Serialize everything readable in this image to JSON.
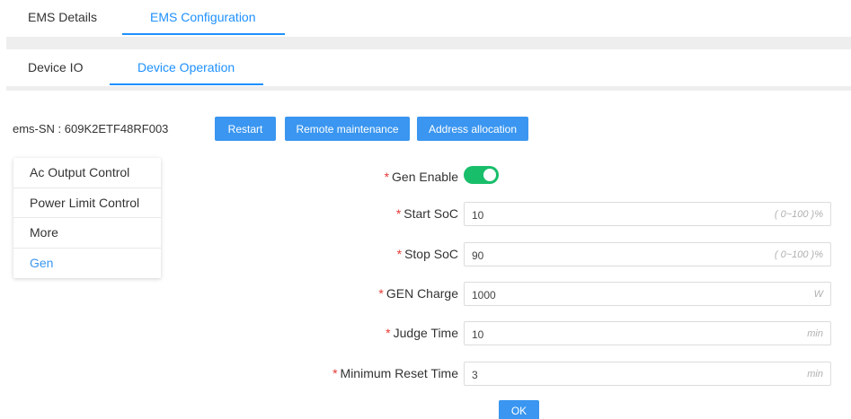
{
  "top_tabs": [
    {
      "label": "EMS Details",
      "active": false
    },
    {
      "label": "EMS Configuration",
      "active": true
    }
  ],
  "sub_tabs": [
    {
      "label": "Device IO",
      "active": false
    },
    {
      "label": "Device Operation",
      "active": true
    }
  ],
  "sn": {
    "label": "ems-SN : 609K2ETF48RF003"
  },
  "actions": {
    "restart": "Restart",
    "remote_maintenance": "Remote maintenance",
    "address_allocation": "Address allocation"
  },
  "menu": {
    "items": [
      {
        "label": "Ac Output Control",
        "active": false
      },
      {
        "label": "Power Limit Control",
        "active": false
      },
      {
        "label": "More",
        "active": false
      },
      {
        "label": "Gen",
        "active": true
      }
    ]
  },
  "form": {
    "gen_enable": {
      "label": "Gen Enable",
      "required": "*",
      "enabled": true
    },
    "start_soc": {
      "label": "Start SoC",
      "required": "*",
      "value": "10",
      "unit": "( 0~100 )%"
    },
    "stop_soc": {
      "label": "Stop SoC",
      "required": "*",
      "value": "90",
      "unit": "( 0~100 )%"
    },
    "gen_charge": {
      "label": "GEN Charge",
      "required": "*",
      "value": "1000",
      "unit": "W"
    },
    "judge_time": {
      "label": "Judge Time",
      "required": "*",
      "value": "10",
      "unit": "min"
    },
    "min_reset_time": {
      "label": "Minimum Reset Time",
      "required": "*",
      "value": "3",
      "unit": "min"
    }
  },
  "ok_label": "OK",
  "colors": {
    "accent": "#3a96f0",
    "toggle_on": "#19be6b",
    "required": "#e53935"
  }
}
